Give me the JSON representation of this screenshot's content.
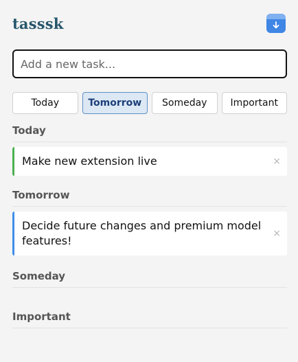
{
  "app": {
    "title": "tasssk"
  },
  "input": {
    "placeholder": "Add a new task...",
    "value": ""
  },
  "filters": [
    {
      "label": "Today",
      "active": false
    },
    {
      "label": "Tomorrow",
      "active": true
    },
    {
      "label": "Someday",
      "active": false
    },
    {
      "label": "Important",
      "active": false
    }
  ],
  "sections": {
    "today": {
      "title": "Today",
      "tasks": [
        {
          "text": "Make new extension live",
          "accent": "#4caf50"
        }
      ]
    },
    "tomorrow": {
      "title": "Tomorrow",
      "tasks": [
        {
          "text": "Decide future changes and premium model features!",
          "accent": "#3f8ee8"
        }
      ]
    },
    "someday": {
      "title": "Someday",
      "tasks": []
    },
    "important": {
      "title": "Important",
      "tasks": []
    }
  },
  "icons": {
    "save": "save-download-icon",
    "delete": "close-icon",
    "delete_glyph": "×"
  },
  "colors": {
    "brand": "#27566b",
    "accent_blue": "#3f86e5",
    "active_filter_bg": "#dce8f4",
    "today_accent": "#4caf50",
    "tomorrow_accent": "#3f8ee8"
  }
}
